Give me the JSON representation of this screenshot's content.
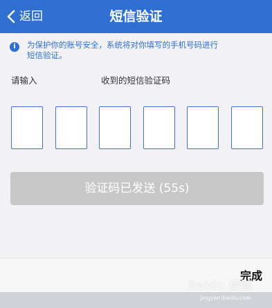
{
  "nav": {
    "back_label": "返回",
    "title": "短信验证"
  },
  "notice": {
    "icon": "info-icon",
    "text_line1": "为保护你的账号安全，系统将对你填写的手机号码进行",
    "text_line2": "短信验证。"
  },
  "labels": {
    "left": "请输入",
    "right": "收到的短信验证码"
  },
  "code": {
    "length": 6,
    "digits": [
      "",
      "",
      "",
      "",
      "",
      ""
    ]
  },
  "send_button": {
    "label": "验证码已发送 (55s)",
    "enabled": false
  },
  "toolbar": {
    "done_label": "完成"
  },
  "watermark": {
    "main": "Baidu 经验",
    "sub": "jingyan.baidu.com"
  },
  "colors": {
    "accent": "#2f6fd1",
    "button_disabled": "#c7c7c7",
    "background": "#f2f2f4"
  }
}
